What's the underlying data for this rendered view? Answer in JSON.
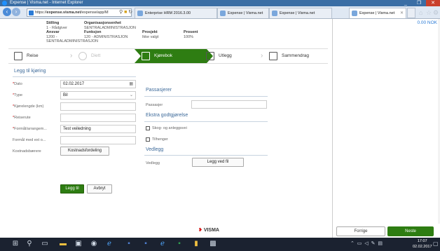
{
  "window": {
    "title": "Expense | Visma.net - Internet Explorer",
    "min": "_",
    "max": "❐",
    "close": "✕"
  },
  "browser": {
    "url_prefix": "https://",
    "url_host": "expense.visma.net",
    "url_rest": "/expense/app/M",
    "tabs": [
      {
        "label": "Enterprise HRM 2016.3.00"
      },
      {
        "label": "Expense | Visma.net"
      },
      {
        "label": "Expense | Visma.net"
      },
      {
        "label": "Expense | Visma.net",
        "active": true
      }
    ]
  },
  "info": {
    "stilling_label": "Stilling",
    "stilling_value": "1 - Rådgiver",
    "orgenhet_label": "Organisasjonsenhet",
    "orgenhet_value": "SENTRALADMINISTRASJON",
    "ansvar_label": "Ansvar",
    "ansvar_value": "1200 - SENTRALADMINISTRASJON",
    "funksjon_label": "Funksjon",
    "funksjon_value": "120 - ADMINISTRASJON",
    "prosjekt_label": "Prosjekt",
    "prosjekt_value": "Ikke valgt",
    "prosent_label": "Prosent",
    "prosent_value": "100%"
  },
  "steps": [
    {
      "label": "Reise",
      "state": "done"
    },
    {
      "label": "Diett",
      "state": "disabled"
    },
    {
      "label": "Kjørebok",
      "state": "active"
    },
    {
      "label": "Utlegg",
      "state": "pending"
    },
    {
      "label": "Sammendrag",
      "state": "pending"
    }
  ],
  "form": {
    "section_title": "Legg til kjøring",
    "fields": {
      "dato_label": "Dato",
      "dato_value": "02.02.2017",
      "type_label": "Type",
      "type_value": "Bil",
      "kjorelengde_label": "Kjørelengde (km)",
      "kjorelengde_value": "",
      "reiserute_label": "Reiserute",
      "reiserute_value": "",
      "formal_label": "Formål/arrangem...",
      "formal_value": "Test veiledning",
      "formal_ekst_label": "Formål med ext o...",
      "formal_ekst_value": "",
      "kostnadsbaerere_label": "Kostnadsbærere",
      "kostnadsfordeling_button": "Kostnadsfordeling"
    },
    "add_button": "Legg til",
    "cancel_button": "Avbryt"
  },
  "passengers": {
    "title": "Passasjerer",
    "label": "Passasjer",
    "value": ""
  },
  "extras": {
    "title": "Ekstra godtgjørelse",
    "option1": "Skog- og anleggsvei",
    "option2": "Tilhenger"
  },
  "attachment": {
    "title": "Vedlegg",
    "label": "Vedlegg",
    "button": "Legg ved fil"
  },
  "summary": {
    "total": "0.00 NOK"
  },
  "footer": {
    "logo": "VISMA",
    "prev_button": "Forrige",
    "next_button": "Neste"
  },
  "taskbar": {
    "time": "17:07",
    "date": "02.02.2017"
  },
  "colors": {
    "accent_green": "#2e7d12",
    "link_blue": "#3d6a9a",
    "required_red": "#c00000",
    "brand_red": "#d71a1a"
  }
}
